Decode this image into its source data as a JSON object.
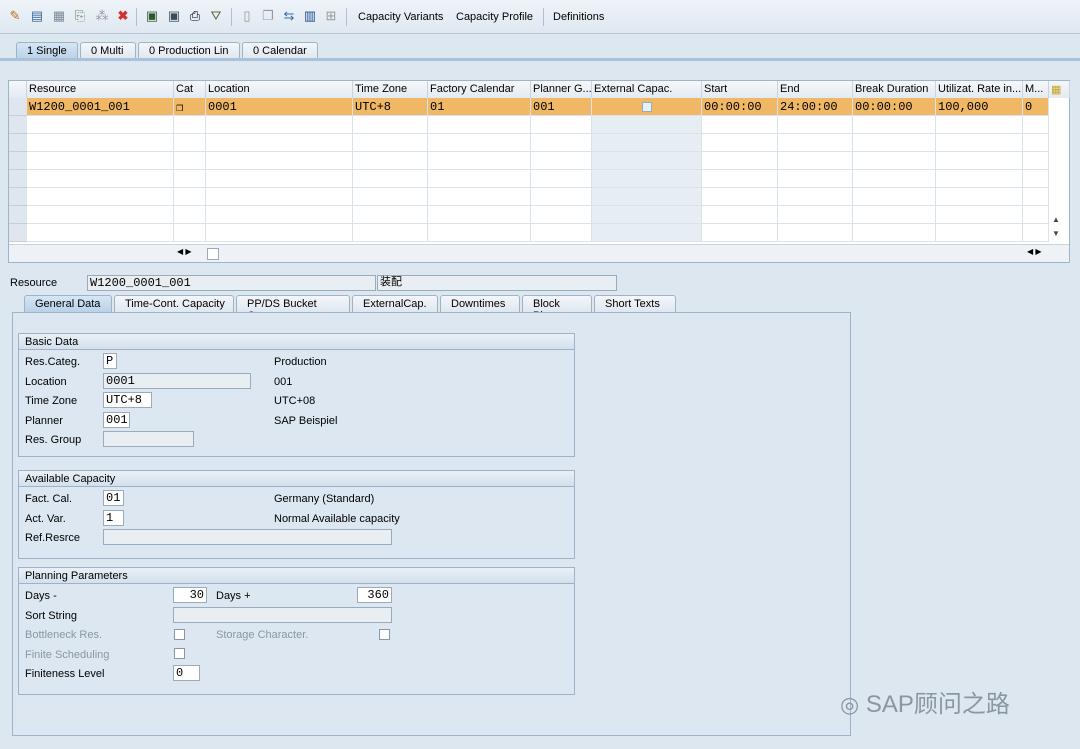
{
  "toolbar": {
    "buttons": [
      "Capacity Variants",
      "Capacity Profile",
      "Definitions"
    ],
    "icons": [
      "wand-icon",
      "table-icon",
      "grid-icon",
      "export-icon",
      "link-icon",
      "delete-icon",
      "doc-icon",
      "doc2-icon",
      "print-icon",
      "filter-icon",
      "trash-icon",
      "copy-icon",
      "move-icon",
      "columns-icon",
      "hierarchy-icon"
    ]
  },
  "top_tabs": [
    "1 Single",
    "0 Multi",
    "0 Production Lin",
    "0 Calendar"
  ],
  "grid": {
    "columns": [
      "Resource",
      "Cat",
      "Location",
      "Time Zone",
      "Factory Calendar",
      "Planner G...",
      "External Capac.",
      "Start",
      "End",
      "Break Duration",
      "Utilizat. Rate in...",
      "M..."
    ],
    "rows": [
      [
        "W1200_0001_001",
        "",
        "0001",
        "UTC+8",
        "01",
        "001",
        "",
        "00:00:00",
        "24:00:00",
        "00:00:00",
        "100,000",
        "0"
      ]
    ],
    "selected_color": "#f0b864"
  },
  "resource": {
    "label": "Resource",
    "value": "W1200_0001_001",
    "description": "装配"
  },
  "detail_tabs": [
    "General Data",
    "Time-Cont. Capacity",
    "PP/DS Bucket Cap.",
    "ExternalCap.",
    "Downtimes",
    "Block Plng",
    "Short Texts"
  ],
  "basic": {
    "title": "Basic Data",
    "rescateg": {
      "label": "Res.Categ.",
      "value": "P",
      "text": "Production"
    },
    "location": {
      "label": "Location",
      "value": "0001",
      "text": "001"
    },
    "timezone": {
      "label": "Time Zone",
      "value": "UTC+8",
      "text": "UTC+08"
    },
    "planner": {
      "label": "Planner",
      "value": "001",
      "text": "SAP Beispiel"
    },
    "resgroup": {
      "label": "Res. Group",
      "value": ""
    }
  },
  "avail": {
    "title": "Available Capacity",
    "factcal": {
      "label": "Fact. Cal.",
      "value": "01",
      "text": "Germany (Standard)"
    },
    "actvar": {
      "label": "Act. Var.",
      "value": "1",
      "text": "Normal Available capacity"
    },
    "refres": {
      "label": "Ref.Resrce",
      "value": ""
    }
  },
  "plan": {
    "title": "Planning Parameters",
    "days_minus": {
      "label": "Days -",
      "value": "30"
    },
    "days_plus": {
      "label": "Days +",
      "value": "360"
    },
    "sort": {
      "label": "Sort String",
      "value": ""
    },
    "bottleneck": {
      "label": "Bottleneck Res.",
      "checked": false
    },
    "storage": {
      "label": "Storage Character.",
      "checked": false
    },
    "finite": {
      "label": "Finite Scheduling",
      "checked": false
    },
    "fineness": {
      "label": "Finiteness Level",
      "value": "0"
    }
  },
  "watermark": "SAP顾问之路"
}
